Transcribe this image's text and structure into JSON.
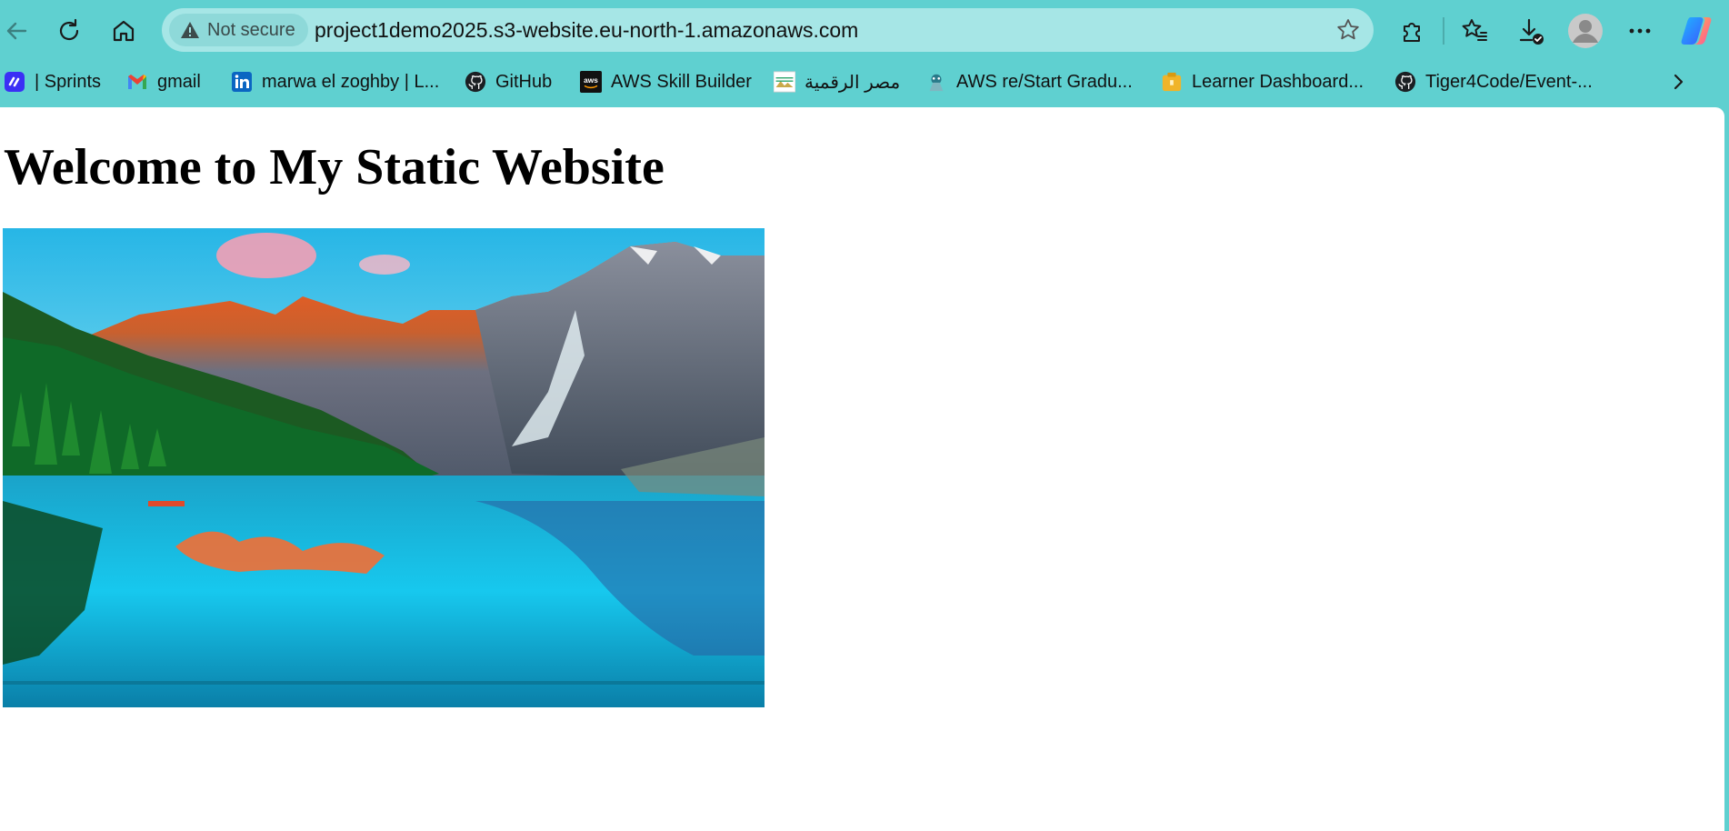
{
  "browser": {
    "security_label": "Not secure",
    "url": "project1demo2025.s3-website.eu-north-1.amazonaws.com",
    "icons": [
      "back-icon",
      "refresh-icon",
      "home-icon",
      "warning-icon",
      "star-icon",
      "extensions-icon",
      "favorites-icon",
      "downloads-icon",
      "profile-icon",
      "more-icon",
      "copilot-icon"
    ]
  },
  "bookmarks": [
    {
      "label": "| Sprints",
      "icon": "sprints-icon"
    },
    {
      "label": "gmail",
      "icon": "gmail-icon"
    },
    {
      "label": "marwa el zoghby | L...",
      "icon": "linkedin-icon"
    },
    {
      "label": "GitHub",
      "icon": "github-icon"
    },
    {
      "label": "AWS Skill Builder",
      "icon": "aws-icon"
    },
    {
      "label": "مصر الرقمية",
      "icon": "misr-digital-icon"
    },
    {
      "label": "AWS re/Start Gradu...",
      "icon": "aws-restart-icon"
    },
    {
      "label": "Learner Dashboard...",
      "icon": "learner-dashboard-icon"
    },
    {
      "label": "Tiger4Code/Event-...",
      "icon": "github-icon"
    }
  ],
  "page": {
    "heading": "Welcome to My Static Website"
  },
  "colors": {
    "chrome": "#5fd0d0",
    "address_bar": "#a6e6e6",
    "page_bg": "#ffffff"
  }
}
